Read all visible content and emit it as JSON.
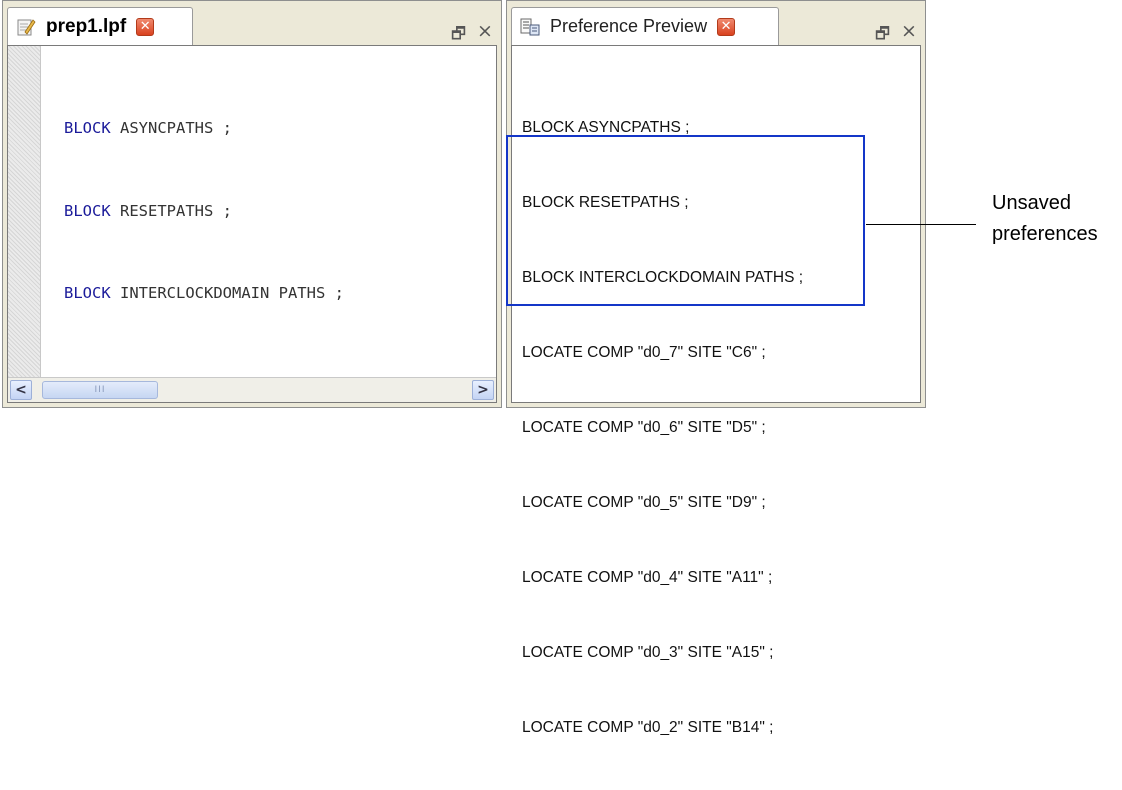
{
  "left_panel": {
    "tab_title": "prep1.lpf",
    "tab_icon": "edit-document-icon",
    "code_lines": [
      {
        "keyword": "BLOCK",
        "rest": " ASYNCPATHS ;"
      },
      {
        "keyword": "BLOCK",
        "rest": " RESETPATHS ;"
      },
      {
        "keyword": "BLOCK",
        "rest": " INTERCLOCKDOMAIN PATHS ;"
      }
    ],
    "scroll_left": "<",
    "scroll_right": ">",
    "thumb_grip": "III"
  },
  "right_panel": {
    "tab_title": "Preference Preview",
    "tab_icon": "preference-preview-icon",
    "lines": [
      "BLOCK ASYNCPATHS ;",
      "BLOCK RESETPATHS ;",
      "BLOCK INTERCLOCKDOMAIN PATHS ;",
      "LOCATE COMP \"d0_7\" SITE \"C6\" ;",
      "LOCATE COMP \"d0_6\" SITE \"D5\" ;",
      "LOCATE COMP \"d0_5\" SITE \"D9\" ;",
      "LOCATE COMP \"d0_4\" SITE \"A11\" ;",
      "LOCATE COMP \"d0_3\" SITE \"A15\" ;",
      "LOCATE COMP \"d0_2\" SITE \"B14\" ;"
    ]
  },
  "controls": {
    "close_glyph": "×",
    "restore_glyph": "🗗",
    "tab_close_glyph": "✕"
  },
  "callout": {
    "line1": "Unsaved",
    "line2": "preferences"
  },
  "colors": {
    "keyword": "#1b1b9a",
    "highlight_border": "#1436c8",
    "tab_close": "#d9421f"
  }
}
